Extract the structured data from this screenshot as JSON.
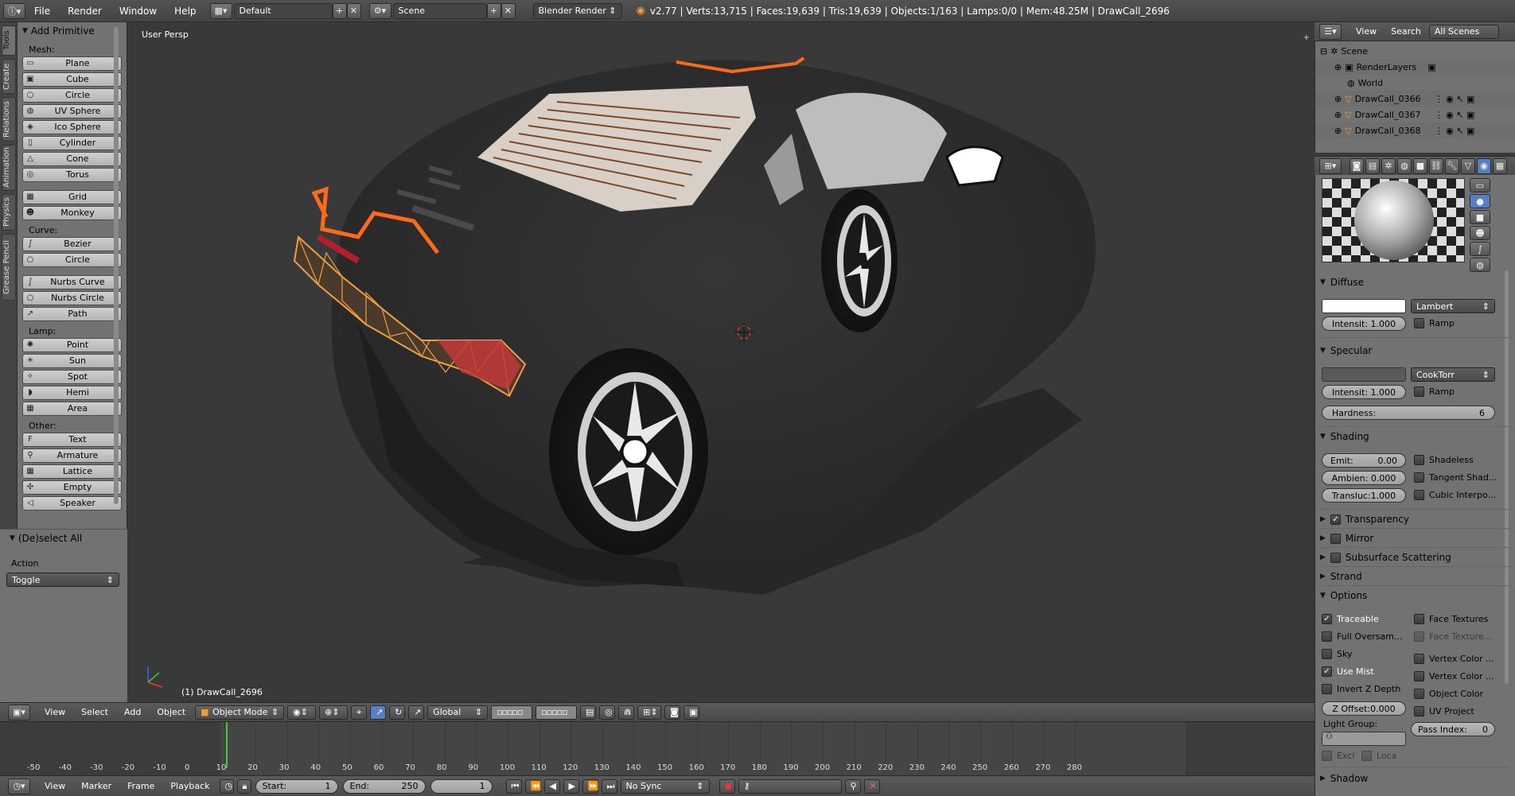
{
  "topbar": {
    "menus": [
      "File",
      "Render",
      "Window",
      "Help"
    ],
    "layout_name": "Default",
    "scene_name": "Scene",
    "render_engine": "Blender Render",
    "stats": "v2.77 | Verts:13,715 | Faces:19,639 | Tris:19,639 | Objects:1/163 | Lamps:0/0 | Mem:48.25M | DrawCall_2696"
  },
  "vtabs": [
    "Tools",
    "Create",
    "Relations",
    "Animation",
    "Physics",
    "Grease Pencil"
  ],
  "toolshelf": {
    "title": "Add Primitive",
    "mesh_label": "Mesh:",
    "mesh": [
      "Plane",
      "Cube",
      "Circle",
      "UV Sphere",
      "Ico Sphere",
      "Cylinder",
      "Cone",
      "Torus",
      "Grid",
      "Monkey"
    ],
    "curve_label": "Curve:",
    "curve": [
      "Bezier",
      "Circle",
      "Nurbs Curve",
      "Nurbs Circle",
      "Path"
    ],
    "lamp_label": "Lamp:",
    "lamp": [
      "Point",
      "Sun",
      "Spot",
      "Hemi",
      "Area"
    ],
    "other_label": "Other:",
    "other": [
      "Text",
      "Armature",
      "Lattice",
      "Empty",
      "Speaker"
    ]
  },
  "operator": {
    "title": "(De)select All",
    "action_label": "Action",
    "action_value": "Toggle"
  },
  "viewport": {
    "view_name": "User Persp",
    "object_label": "(1) DrawCall_2696"
  },
  "vp_header": {
    "menus": [
      "View",
      "Select",
      "Add",
      "Object"
    ],
    "mode": "Object Mode",
    "orientation": "Global"
  },
  "timeline": {
    "ticks": [
      "-50",
      "-40",
      "-30",
      "-20",
      "-10",
      "0",
      "10",
      "20",
      "30",
      "40",
      "50",
      "60",
      "70",
      "80",
      "90",
      "100",
      "110",
      "120",
      "130",
      "140",
      "150",
      "160",
      "170",
      "180",
      "190",
      "200",
      "210",
      "220",
      "230",
      "240",
      "250",
      "260",
      "270",
      "280"
    ],
    "menus": [
      "View",
      "Marker",
      "Frame",
      "Playback"
    ],
    "start_label": "Start:",
    "start_value": "1",
    "end_label": "End:",
    "end_value": "250",
    "current_frame": "1",
    "sync": "No Sync"
  },
  "outliner": {
    "menus": [
      "View",
      "Search"
    ],
    "filter": "All Scenes",
    "rows": [
      "Scene",
      "RenderLayers",
      "World",
      "DrawCall_0366",
      "DrawCall_0367",
      "DrawCall_0368"
    ]
  },
  "material": {
    "diffuse_title": "Diffuse",
    "diffuse_shader": "Lambert",
    "diffuse_intensity": "Intensit: 1.000",
    "ramp": "Ramp",
    "specular_title": "Specular",
    "specular_shader": "CookTorr",
    "specular_intensity": "Intensit: 1.000",
    "hardness_label": "Hardness:",
    "hardness_value": "6",
    "shading_title": "Shading",
    "emit": "Emit:",
    "emit_value": "0.00",
    "ambient": "Ambien: 0.000",
    "transluc": "Transluc:1.000",
    "shadeless": "Shadeless",
    "tangent": "Tangent Shad...",
    "cubic": "Cubic Interpo...",
    "transparency": "Transparency",
    "mirror": "Mirror",
    "sss": "Subsurface Scattering",
    "strand": "Strand",
    "options_title": "Options",
    "traceable": "Traceable",
    "face_textures": "Face Textures",
    "full_oversam": "Full Oversam...",
    "face_texture_alpha": "Face Texture...",
    "sky": "Sky",
    "vertex_color_1": "Vertex Color ...",
    "use_mist": "Use Mist",
    "vertex_color_2": "Vertex Color ...",
    "invert_z": "Invert Z Depth",
    "object_color": "Object Color",
    "z_offset": "Z Offset:0.000",
    "uv_project": "UV Project",
    "light_group": "Light Group:",
    "pass_index_label": "Pass Index:",
    "pass_index_value": "0",
    "excl": "Excl",
    "loca": "Loca",
    "shadow": "Shadow"
  },
  "colors": {
    "accent_orange": "#ff6a1a",
    "selection_orange": "#f0a040",
    "timeline_current": "#3ec93e"
  }
}
